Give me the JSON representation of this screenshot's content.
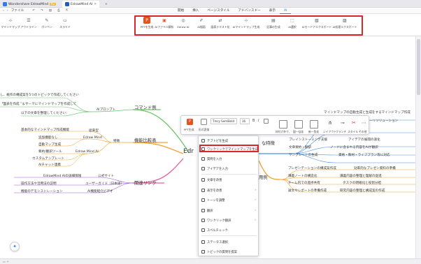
{
  "titlebar": {
    "tabs": [
      {
        "label": "Wondershare EdrawMind",
        "badge": "Pro"
      },
      {
        "label": "EdrawMind AI"
      }
    ],
    "add": "+"
  },
  "menubar": {
    "file": "ファイル",
    "ribbon_tabs": [
      "開始",
      "挿入",
      "ページスタイル",
      "アドバンスドー",
      "表示",
      "AI"
    ],
    "active_tab": "AI"
  },
  "toolbar": {
    "left_buttons": [
      "マインドマップ",
      "アウトライン",
      "ポンペン",
      "スライド"
    ],
    "ai_buttons": [
      "PPTを生成",
      "AIファイル解析",
      "Edraw AI",
      "AI描画",
      "図表テキスト化",
      "AIマインドマップ生成",
      "記事の生成",
      "AI選択",
      "AIモードアエクスポート",
      "AI処理エクスポート"
    ]
  },
  "mindmap": {
    "central": "Edr",
    "branches": {
      "command": "コマンド例",
      "features": "機能比較表",
      "links": "関連リンク",
      "special": "な特徴",
      "usecases": "用例"
    },
    "command_items": [
      "し、紙作の構成案を5つのトピックで作成してください",
      "「図表を作成 ”＆サーマにマインドマップを作成して",
      "以下の文章を整理してください："
    ],
    "ai_example": "AIプロンプト",
    "features": [
      [
        "基本的なマインドマップ作成機能",
        "従来型"
      ],
      [
        "追加機能なし",
        "Edraw Mind"
      ],
      [
        "自動マップ生成",
        ""
      ],
      [
        "要約/翻訳ツール",
        "Edraw Mind AI"
      ],
      [
        "カスタムテンプレート",
        ""
      ],
      [
        "AIチャット連携",
        ""
      ]
    ],
    "features_label": "特徴",
    "links": [
      [
        "EdrawMind AIの詳細情報",
        "公式サイト"
      ],
      [
        "操作方法や活用法の説明",
        "ユーザーガイド（日本語）"
      ],
      [
        "機能のデモンストレーション",
        "AI機能紹介ビデオ"
      ]
    ],
    "special_items": [
      "マインドマップの自動生成と生成をするマインドマップ作成",
      "ーリソリューション",
      "ブレインストーミング支援",
      "アイデアの展開の速化",
      "文章要約・翻訳",
      "ノードに含まれる内容をAIが翻訳",
      "サングレートの生成",
      "資格・教材・ライフプラン等に対応"
    ],
    "usecases": [
      [
        "プレゼンテーションの構成案作成",
        "効率的なプレゼン資料の準備"
      ],
      [
        "講義ノートの構造化",
        "講義内容の整理と理解の促進"
      ],
      [
        "チーム内での進捗共有",
        "タスクの明確化と役割分担"
      ],
      [
        "論文やレポートの準備作成",
        "研究内容の整理と構成案の作成"
      ]
    ]
  },
  "floating_toolbar": {
    "font": "Tmcy SemiBold",
    "size": "16",
    "labels": [
      "PPT生成",
      "形式変換",
      "枠付け外で、",
      "図一括化",
      "新一覧化",
      "レイアウト",
      "ブランチ",
      "スタイル",
      "その他"
    ]
  },
  "context_menu": {
    "items": [
      {
        "label": "テブトビを生成",
        "arrow": false
      },
      {
        "label": "ワンクリックでマインドマップを生成",
        "arrow": false
      },
      {
        "label": "質問を入力",
        "arrow": false
      },
      {
        "label": "アイデアを入力",
        "arrow": false
      },
      {
        "label": "文章を改善",
        "arrow": false
      },
      {
        "label": "表示を改善",
        "arrow": true
      },
      {
        "label": "トーンを調整",
        "arrow": true
      },
      {
        "label": "翻訳",
        "arrow": true
      },
      {
        "label": "ワンクリック翻訳",
        "arrow": true
      },
      {
        "label": "スペルチェック",
        "arrow": false
      },
      {
        "label": "ステータス選択",
        "arrow": false
      },
      {
        "label": "トピックの質問を提案",
        "arrow": false
      }
    ]
  },
  "colors": {
    "accent": "#2d7cf6",
    "highlight": "#d9262c",
    "branch_green": "#6ac46a",
    "branch_orange": "#f0a030",
    "branch_purple": "#9b59d0",
    "branch_pink": "#e060a0"
  }
}
